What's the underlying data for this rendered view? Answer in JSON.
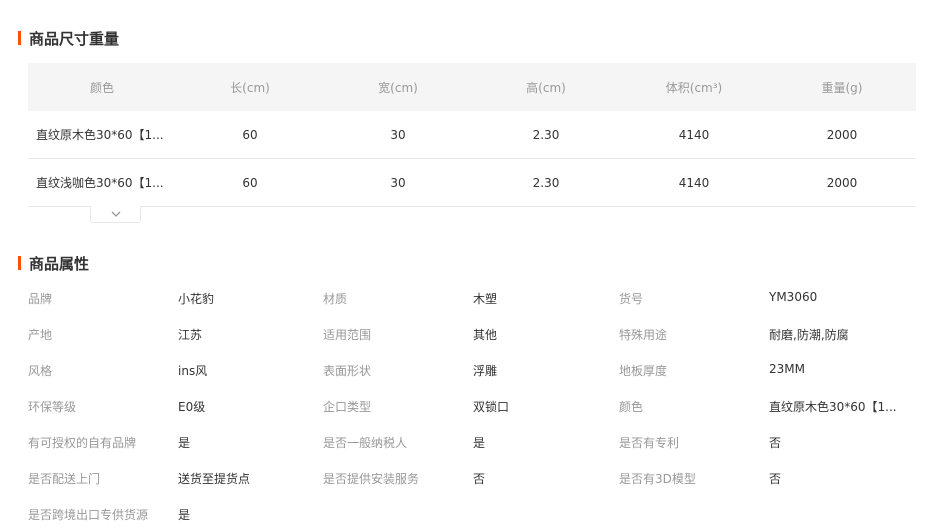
{
  "size_section": {
    "title": "商品尺寸重量",
    "headers": [
      "颜色",
      "长(cm)",
      "宽(cm)",
      "高(cm)",
      "体积(cm³)",
      "重量(g)"
    ],
    "rows": [
      [
        "直纹原木色30*60【1...",
        "60",
        "30",
        "2.30",
        "4140",
        "2000"
      ],
      [
        "直纹浅咖色30*60【1...",
        "60",
        "30",
        "2.30",
        "4140",
        "2000"
      ]
    ],
    "expand_icon": "chevron-down-icon"
  },
  "attr_section": {
    "title": "商品属性",
    "rows": [
      [
        [
          "品牌",
          "小花豹"
        ],
        [
          "材质",
          "木塑"
        ],
        [
          "货号",
          "YM3060"
        ]
      ],
      [
        [
          "产地",
          "江苏"
        ],
        [
          "适用范围",
          "其他"
        ],
        [
          "特殊用途",
          "耐磨,防潮,防腐"
        ]
      ],
      [
        [
          "风格",
          "ins风"
        ],
        [
          "表面形状",
          "浮雕"
        ],
        [
          "地板厚度",
          "23MM"
        ]
      ],
      [
        [
          "环保等级",
          "E0级"
        ],
        [
          "企口类型",
          "双锁口"
        ],
        [
          "颜色",
          "直纹原木色30*60【1..."
        ]
      ],
      [
        [
          "有可授权的自有品牌",
          "是"
        ],
        [
          "是否一般纳税人",
          "是"
        ],
        [
          "是否有专利",
          "否"
        ]
      ],
      [
        [
          "是否配送上门",
          "送货至提货点"
        ],
        [
          "是否提供安装服务",
          "否"
        ],
        [
          "是否有3D模型",
          "否"
        ]
      ],
      [
        [
          "是否跨境出口专供货源",
          "是"
        ]
      ]
    ]
  },
  "colors": {
    "accent": "#ff5000",
    "header_bg": "#f5f5f5",
    "label": "#999999",
    "text": "#333333"
  }
}
